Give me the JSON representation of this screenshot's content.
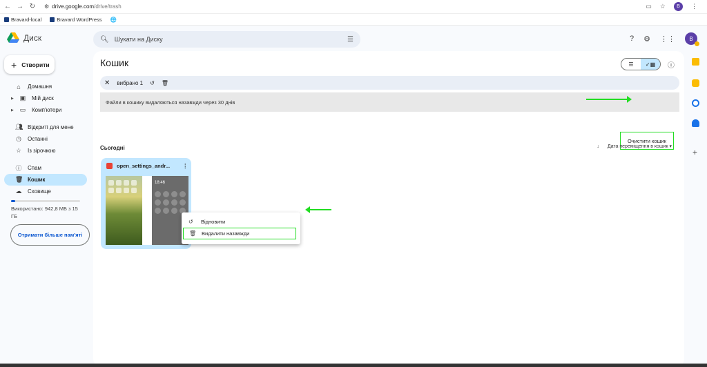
{
  "browser": {
    "url_host": "drive.google.com",
    "url_path": "/drive/trash",
    "bookmarks": [
      "Bravard-local",
      "Bravard WordPress"
    ],
    "profile_initial": "B"
  },
  "header": {
    "app_name": "Диск",
    "search_placeholder": "Шукати на Диску",
    "account_initial": "B"
  },
  "sidebar": {
    "create_label": "Створити",
    "items": [
      {
        "label": "Домашня",
        "icon": "home-icon"
      },
      {
        "label": "Мій диск",
        "icon": "my-drive-icon"
      },
      {
        "label": "Комп'ютери",
        "icon": "computers-icon"
      },
      {
        "label": "Відкриті для мене",
        "icon": "shared-icon"
      },
      {
        "label": "Останні",
        "icon": "recent-icon"
      },
      {
        "label": "Із зірочкою",
        "icon": "star-icon"
      },
      {
        "label": "Спам",
        "icon": "spam-icon"
      },
      {
        "label": "Кошик",
        "icon": "trash-icon"
      },
      {
        "label": "Сховище",
        "icon": "cloud-icon"
      }
    ],
    "storage_text": "Використано: 942,8 МБ з 15 ГБ",
    "storage_used_fraction": 0.063,
    "more_storage_label": "Отримати більше пам'яті"
  },
  "main": {
    "title": "Кошик",
    "selection_text": "вибрано 1",
    "banner_text": "Файли в кошику видаляються назавжди через 30 днів",
    "empty_trash_label": "Очистити кошик",
    "section_label": "Сьогодні",
    "sort_label": "Дата переміщення в кошик",
    "file": {
      "name": "open_settings_andr...",
      "thumb_time": "18:46"
    },
    "context_menu": {
      "restore_label": "Відновити",
      "delete_forever_label": "Видалити назавжди"
    }
  },
  "colors": {
    "accent": "#0b57d0",
    "selection": "#c2e7ff",
    "highlight": "#22dd22"
  }
}
